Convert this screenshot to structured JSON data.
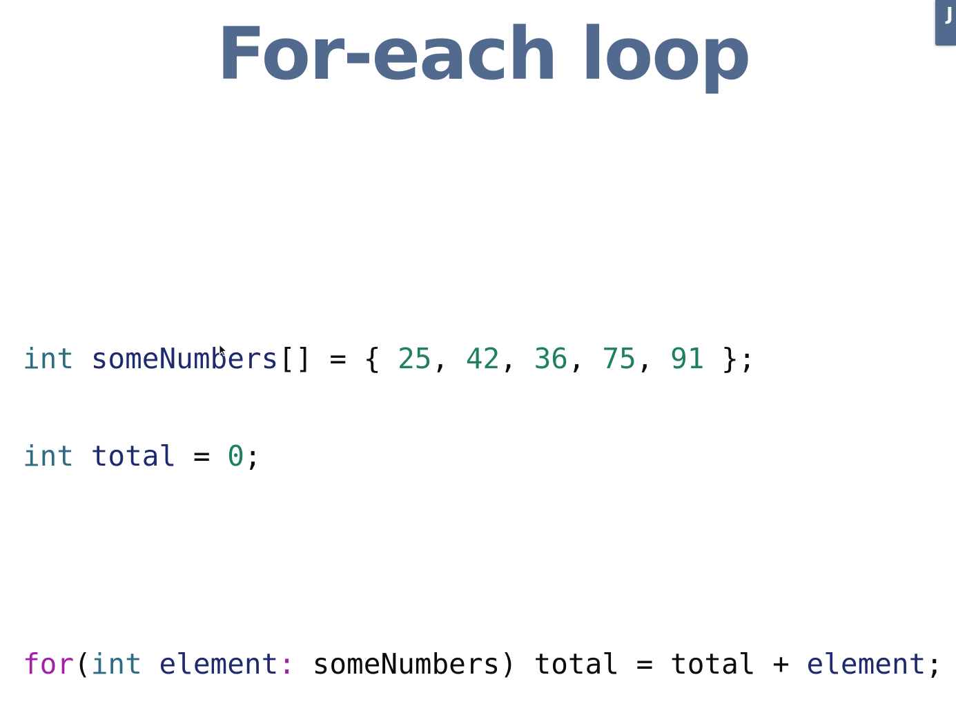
{
  "slide": {
    "title": "For-each loop"
  },
  "corner_tab": {
    "glyph": "J"
  },
  "code": {
    "line1": {
      "type": "int",
      "name": "someNumbers",
      "decl_suffix": "[] = { ",
      "values": [
        "25",
        "42",
        "36",
        "75",
        "91"
      ],
      "sep": ", ",
      "end": " };"
    },
    "line2": {
      "type": "int",
      "name": "total",
      "assign": " = ",
      "value": "0",
      "end": ";"
    },
    "line3": {
      "keyword": "for",
      "open": "(",
      "type": "int",
      "var": "element",
      "colon": ":",
      "collection": " someNumbers) total = total + ",
      "var2": "element",
      "end": ";"
    }
  },
  "colors": {
    "title": "#526a8e",
    "type_keyword": "#2d6d84",
    "control_keyword": "#a21fa8",
    "identifier": "#1f2a6e",
    "number": "#1d8063"
  },
  "icons": {
    "cursor": "mouse-pointer-icon"
  }
}
